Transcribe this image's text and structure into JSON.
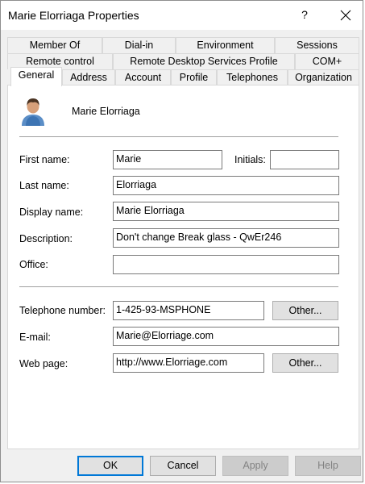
{
  "window": {
    "title": "Marie Elorriaga Properties",
    "help_glyph": "?"
  },
  "tabs_row1": [
    "Member Of",
    "Dial-in",
    "Environment",
    "Sessions"
  ],
  "tabs_row2": [
    "Remote control",
    "Remote Desktop Services Profile",
    "COM+"
  ],
  "tabs_row3": [
    "General",
    "Address",
    "Account",
    "Profile",
    "Telephones",
    "Organization"
  ],
  "active_tab": "General",
  "user": {
    "display": "Marie Elorriaga"
  },
  "fields": {
    "first_name_label": "First name:",
    "first_name": "Marie",
    "initials_label": "Initials:",
    "initials": "",
    "last_name_label": "Last name:",
    "last_name": "Elorriaga",
    "display_name_label": "Display name:",
    "display_name": "Marie Elorriaga",
    "description_label": "Description:",
    "description": "Don't change Break glass - QwEr246",
    "office_label": "Office:",
    "office": "",
    "telephone_label": "Telephone number:",
    "telephone": "1-425-93-MSPHONE",
    "email_label": "E-mail:",
    "email": "Marie@Elorriage.com",
    "webpage_label": "Web page:",
    "webpage": "http://www.Elorriage.com"
  },
  "buttons": {
    "other_phone": "Other...",
    "other_web": "Other...",
    "ok": "OK",
    "cancel": "Cancel",
    "apply": "Apply",
    "help": "Help"
  }
}
